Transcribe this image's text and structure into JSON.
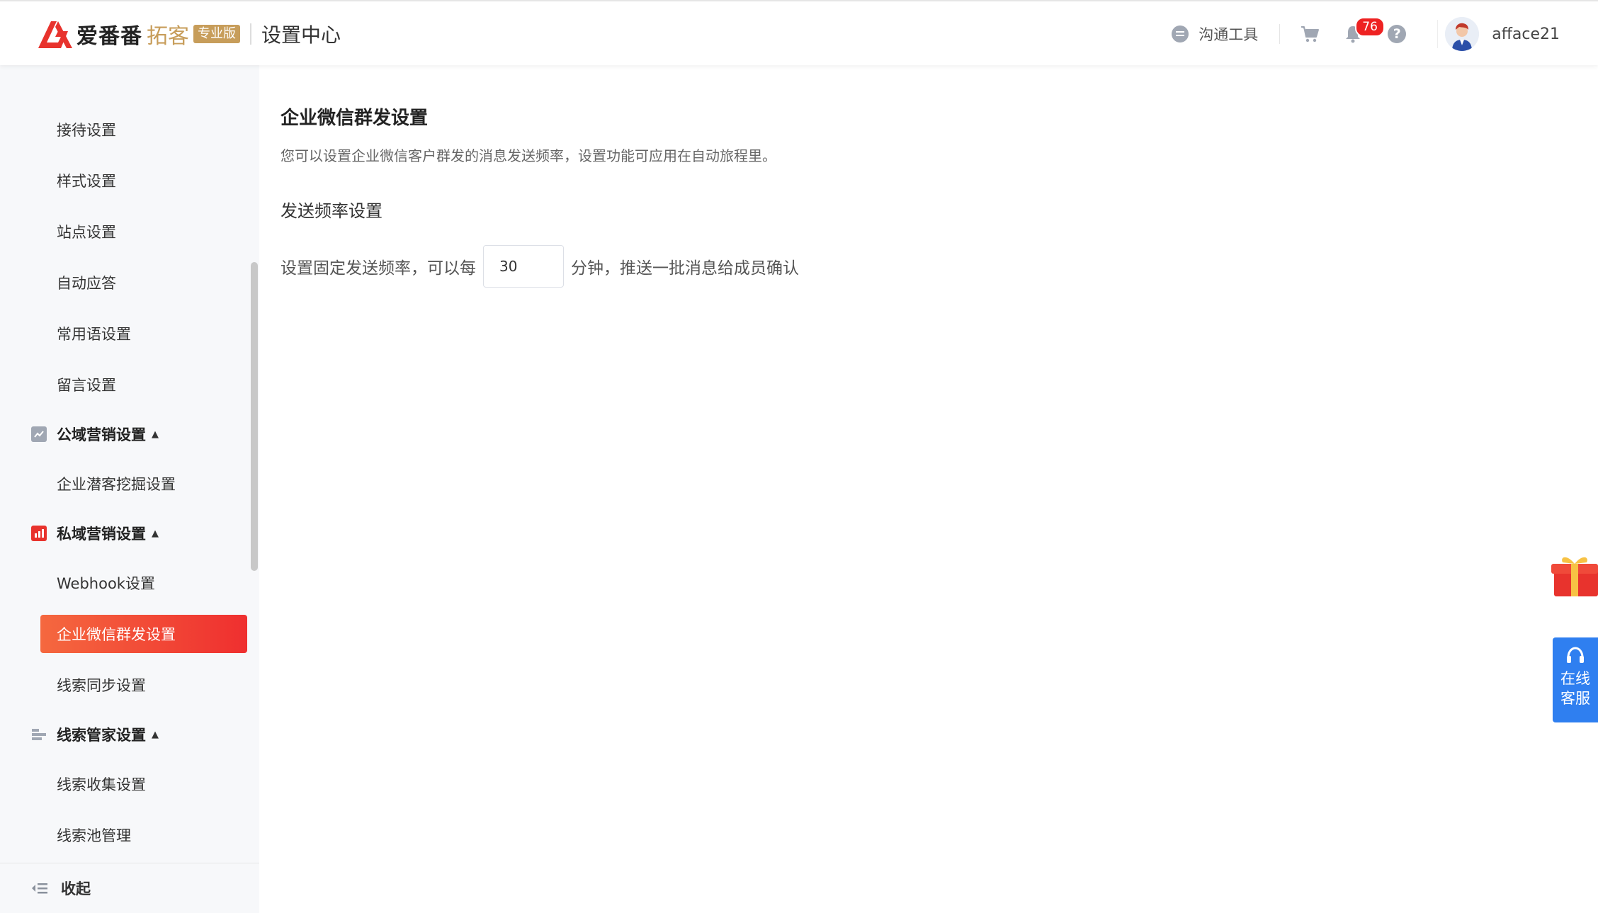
{
  "header": {
    "brand_name": "爱番番",
    "brand_sub": "拓客",
    "brand_badge": "专业版",
    "page_title": "设置中心",
    "tool_label": "沟通工具",
    "notification_count": "76",
    "help_glyph": "?",
    "username": "afface21"
  },
  "sidebar": {
    "items": [
      {
        "label": "接待设置"
      },
      {
        "label": "样式设置"
      },
      {
        "label": "站点设置"
      },
      {
        "label": "自动应答"
      },
      {
        "label": "常用语设置"
      },
      {
        "label": "留言设置"
      }
    ],
    "groups": [
      {
        "label": "公域营销设置",
        "children": [
          "企业潜客挖掘设置"
        ]
      },
      {
        "label": "私域营销设置",
        "children": [
          "Webhook设置",
          "企业微信群发设置",
          "线索同步设置"
        ]
      },
      {
        "label": "线索管家设置",
        "children": [
          "线索收集设置",
          "线索池管理"
        ]
      }
    ],
    "active_item": "企业微信群发设置",
    "collapse_label": "收起"
  },
  "main": {
    "title": "企业微信群发设置",
    "description": "您可以设置企业微信客户群发的消息发送频率，设置功能可应用在自动旅程里。",
    "section_title": "发送频率设置",
    "row_prefix": "设置固定发送频率，可以每",
    "frequency_value": "30",
    "row_suffix": "分钟，推送一批消息给成员确认"
  },
  "float": {
    "service_line1": "在线",
    "service_line2": "客服"
  },
  "colors": {
    "accent": "#ef2f2f",
    "gold": "#c79d5a",
    "service_blue": "#2f7ff0"
  }
}
